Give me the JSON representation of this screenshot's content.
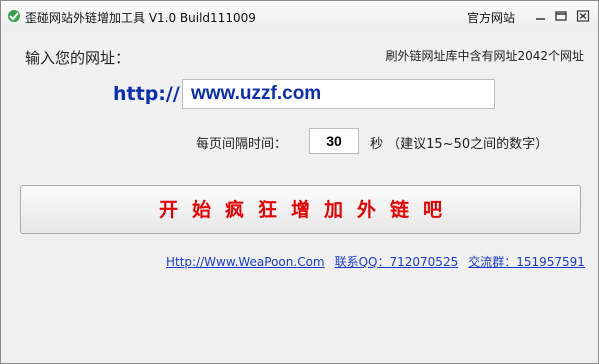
{
  "window": {
    "title": "歪碰网站外链增加工具 V1.0 Build111009",
    "official_site": "官方网站"
  },
  "main": {
    "url_label": "输入您的网址：",
    "url_count": "刷外链网址库中含有网址2042个网址",
    "http_prefix": "http://",
    "url_value": "www.uzzf.com",
    "interval_label": "每页间隔时间：",
    "interval_value": "30",
    "interval_suffix": "秒 （建议15~50之间的数字）",
    "start_button": "开始疯狂增加外链吧"
  },
  "footer": {
    "site_link": "Http://Www.WeaPoon.Com",
    "qq": "联系QQ：712070525",
    "group": "交流群：151957591"
  }
}
